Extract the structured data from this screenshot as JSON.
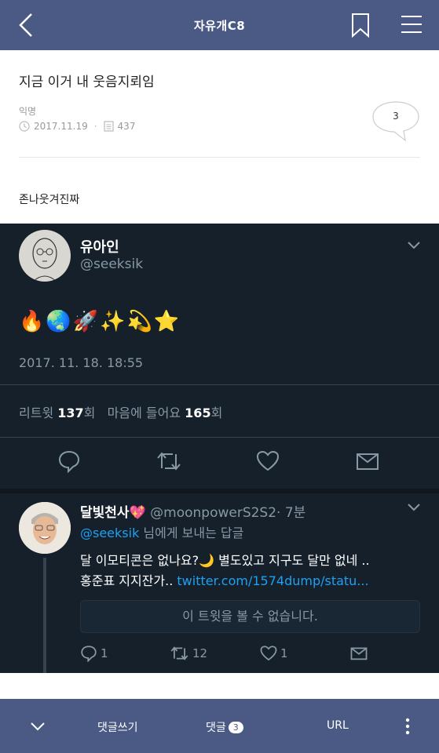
{
  "header": {
    "title": "자유개C8",
    "back_icon": "chevron-left-icon",
    "bookmark_icon": "bookmark-icon",
    "menu_icon": "hamburger-menu-icon"
  },
  "post": {
    "title": "지금 이거 내 웃음지뢰임",
    "author": "익명",
    "date": "2017.11.19",
    "views": "437",
    "comment_count": "3",
    "body": "존나웃겨진짜"
  },
  "tweet": {
    "name": "유아인",
    "handle": "@seeksik",
    "emojis": "🔥🌏🚀✨💫⭐",
    "datetime": "2017. 11. 18. 18:55",
    "retweet_label": "리트윗",
    "retweet_count": "137",
    "like_label": "마음에 들어요",
    "like_count": "165",
    "count_unit": "회"
  },
  "reply": {
    "name": "달빛천사",
    "heart": "💖",
    "handle": "@moonpowerS2S2",
    "time": "· 7분",
    "to_handle": "@seeksik",
    "to_suffix": " 님에게 보내는 답글",
    "text_line1": "달 이모티콘은 없나요?🌙 별도있고 지구도 달만 없네 ..",
    "text_line2_prefix": "홍준표 지지잔가.. ",
    "link": "twitter.com/1574dump/statu...",
    "unavailable": "이 트윗을 볼 수 없습니다.",
    "reply_count": "1",
    "retweet_count": "12",
    "like_count": "1"
  },
  "bottombar": {
    "write_comment": "댓글쓰기",
    "comments": "댓글",
    "comments_badge": "3",
    "url": "URL"
  },
  "colors": {
    "header_bg": "#4a5a85",
    "tweet_bg": "#15202b",
    "link": "#1da1f2",
    "muted": "#8899a6"
  }
}
